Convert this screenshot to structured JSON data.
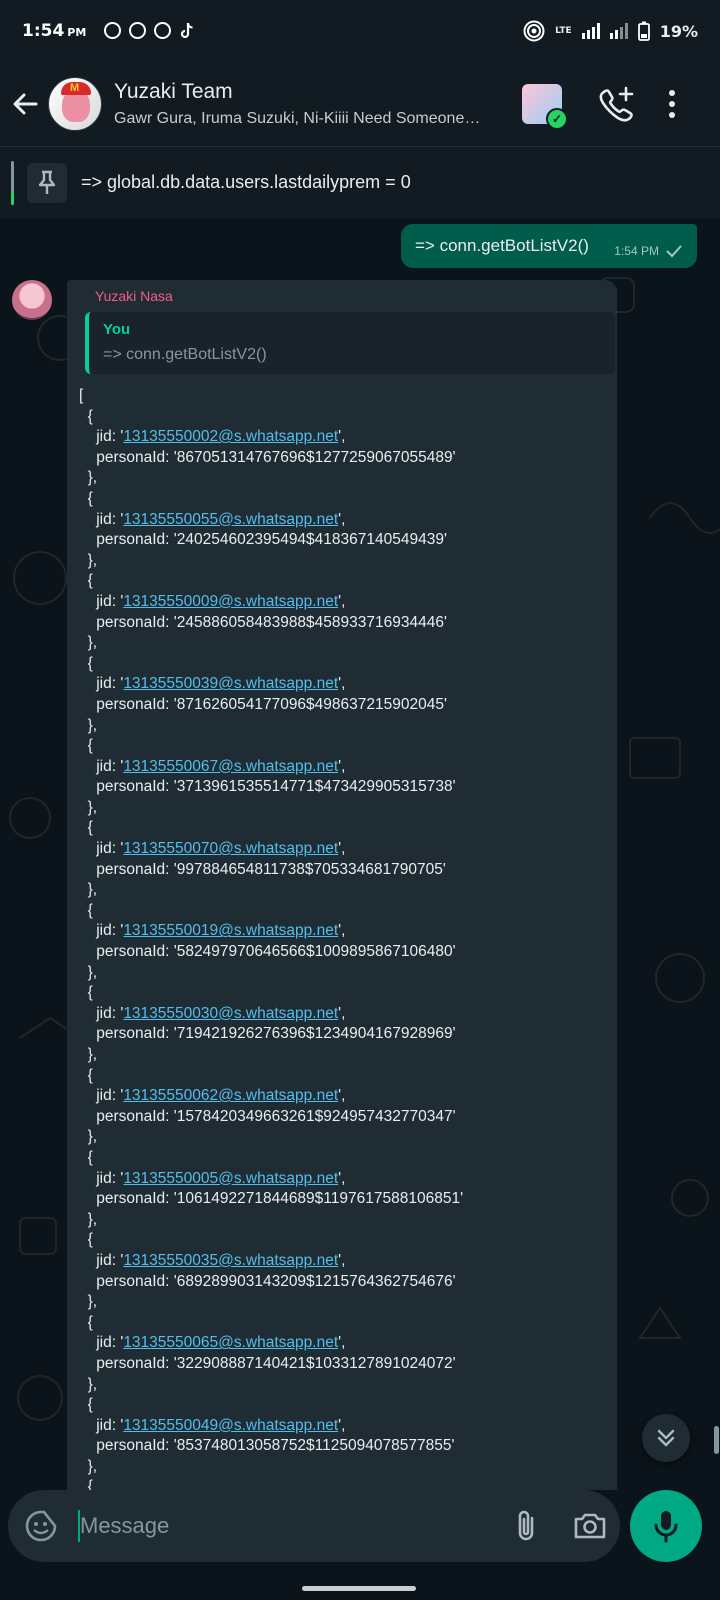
{
  "status_bar": {
    "time": "1:54",
    "ampm": "PM",
    "network": "LTE",
    "battery": "19%",
    "notification_icons": [
      "whatsapp-icon",
      "whatsapp-business-icon",
      "whatsapp-icon",
      "tiktok-icon"
    ]
  },
  "header": {
    "title": "Yuzaki Team",
    "subtitle": "Gawr Gura, Iruma Suzuki, Ni-Kiiii Need Someone…"
  },
  "pinned": {
    "text": "=> global.db.data.users.lastdailyprem = 0"
  },
  "outgoing": {
    "text": "=> conn.getBotListV2()",
    "time": "1:54 PM"
  },
  "incoming": {
    "sender": "Yuzaki Nasa",
    "quote_author": "You",
    "quote_text": "=> conn.getBotListV2()",
    "open_bracket": "[",
    "entries": [
      {
        "jid": "13135550002@s.whatsapp.net",
        "personaId": "867051314767696$1277259067055489"
      },
      {
        "jid": "13135550055@s.whatsapp.net",
        "personaId": "240254602395494$418367140549439"
      },
      {
        "jid": "13135550009@s.whatsapp.net",
        "personaId": "245886058483988$458933716934446"
      },
      {
        "jid": "13135550039@s.whatsapp.net",
        "personaId": "871626054177096$498637215902045"
      },
      {
        "jid": "13135550067@s.whatsapp.net",
        "personaId": "3713961535514771$473429905315738"
      },
      {
        "jid": "13135550070@s.whatsapp.net",
        "personaId": "997884654811738$705334681790705"
      },
      {
        "jid": "13135550019@s.whatsapp.net",
        "personaId": "582497970646566$1009895867106480"
      },
      {
        "jid": "13135550030@s.whatsapp.net",
        "personaId": "719421926276396$1234904167928969"
      },
      {
        "jid": "13135550062@s.whatsapp.net",
        "personaId": "1578420349663261$924957432770347"
      },
      {
        "jid": "13135550005@s.whatsapp.net",
        "personaId": "1061492271844689$1197617588106851"
      },
      {
        "jid": "13135550035@s.whatsapp.net",
        "personaId": "689289903143209$1215764362754676"
      },
      {
        "jid": "13135550065@s.whatsapp.net",
        "personaId": "322908887140421$1033127891024072"
      },
      {
        "jid": "13135550049@s.whatsapp.net",
        "personaId": "853748013058752$1125094078577855"
      }
    ]
  },
  "composer": {
    "placeholder": "Message"
  },
  "colors": {
    "outgoing_bubble": "#005c4b",
    "incoming_bubble": "#202c33",
    "accent": "#00a884",
    "sender_name": "#f15c8d",
    "link": "#53bdeb"
  }
}
